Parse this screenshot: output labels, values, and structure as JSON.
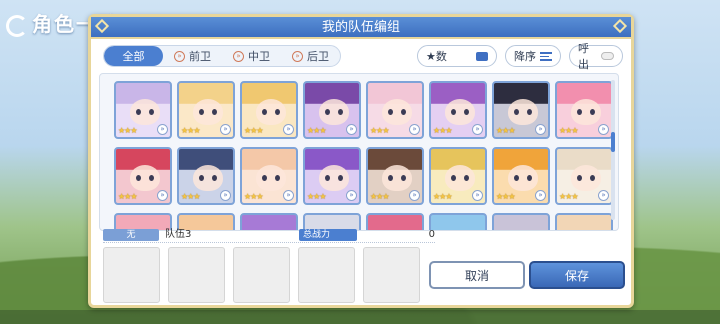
{
  "background": {
    "title": "角色一覧"
  },
  "dialog": {
    "title": "我的队伍编组"
  },
  "filter_tabs": [
    {
      "label": "全部",
      "active": true
    },
    {
      "label": "前卫",
      "active": false
    },
    {
      "label": "中卫",
      "active": false
    },
    {
      "label": "后卫",
      "active": false
    }
  ],
  "sort": {
    "field_label": "★数",
    "order_label": "降序",
    "toggle_label": "呼出"
  },
  "roster": {
    "characters": [
      {
        "stars": "★★★",
        "hair": "#c9b6e8",
        "bg": "#e9def7"
      },
      {
        "stars": "★★★",
        "hair": "#f3d28a",
        "bg": "#fbe8c8"
      },
      {
        "stars": "★★★",
        "hair": "#f0c870",
        "bg": "#fae7c2"
      },
      {
        "stars": "★★★",
        "hair": "#7a4aa8",
        "bg": "#d8c2ee"
      },
      {
        "stars": "★★★",
        "hair": "#f2c6d6",
        "bg": "#f6dbe6"
      },
      {
        "stars": "★★★",
        "hair": "#9b5fc4",
        "bg": "#e4cff2"
      },
      {
        "stars": "★★★",
        "hair": "#2d2d3f",
        "bg": "#c8c8d6"
      },
      {
        "stars": "★★★",
        "hair": "#f28fae",
        "bg": "#f8cfdc"
      },
      {
        "stars": "★★★",
        "hair": "#d6465e",
        "bg": "#f3c7cf"
      },
      {
        "stars": "★★★",
        "hair": "#3f4e7a",
        "bg": "#cbd3e8"
      },
      {
        "stars": "★★★",
        "hair": "#f4c8a8",
        "bg": "#fbe4d4"
      },
      {
        "stars": "★★★",
        "hair": "#8a58c8",
        "bg": "#dcccf3"
      },
      {
        "stars": "★★★",
        "hair": "#6b4a3a",
        "bg": "#e2d0c4"
      },
      {
        "stars": "★★★",
        "hair": "#e6c45c",
        "bg": "#f8ebbe"
      },
      {
        "stars": "★★★",
        "hair": "#f0a43a",
        "bg": "#fbdcae"
      },
      {
        "stars": "★★★",
        "hair": "#eadcc8",
        "bg": "#f6efe4"
      },
      {
        "stars": "",
        "hair": "#f2a9b8",
        "bg": "#f9d9df"
      },
      {
        "stars": "",
        "hair": "#f5c89a",
        "bg": "#fbe5cf"
      },
      {
        "stars": "",
        "hair": "#a77ad6",
        "bg": "#e2d3f4"
      },
      {
        "stars": "",
        "hair": "#d9dbe8",
        "bg": "#eef0f6"
      },
      {
        "stars": "",
        "hair": "#e36a8c",
        "bg": "#f7ccd8"
      },
      {
        "stars": "",
        "hair": "#8fc7ec",
        "bg": "#d6ecf8"
      },
      {
        "stars": "",
        "hair": "#c9c3d8",
        "bg": "#ebe8f1"
      },
      {
        "stars": "",
        "hair": "#f2d6b6",
        "bg": "#faeedf"
      }
    ]
  },
  "team": {
    "badge": "无",
    "name": "队伍3",
    "power_label": "总战力",
    "power_value": "0",
    "slot_count": 5
  },
  "buttons": {
    "cancel": "取消",
    "save": "保存"
  }
}
